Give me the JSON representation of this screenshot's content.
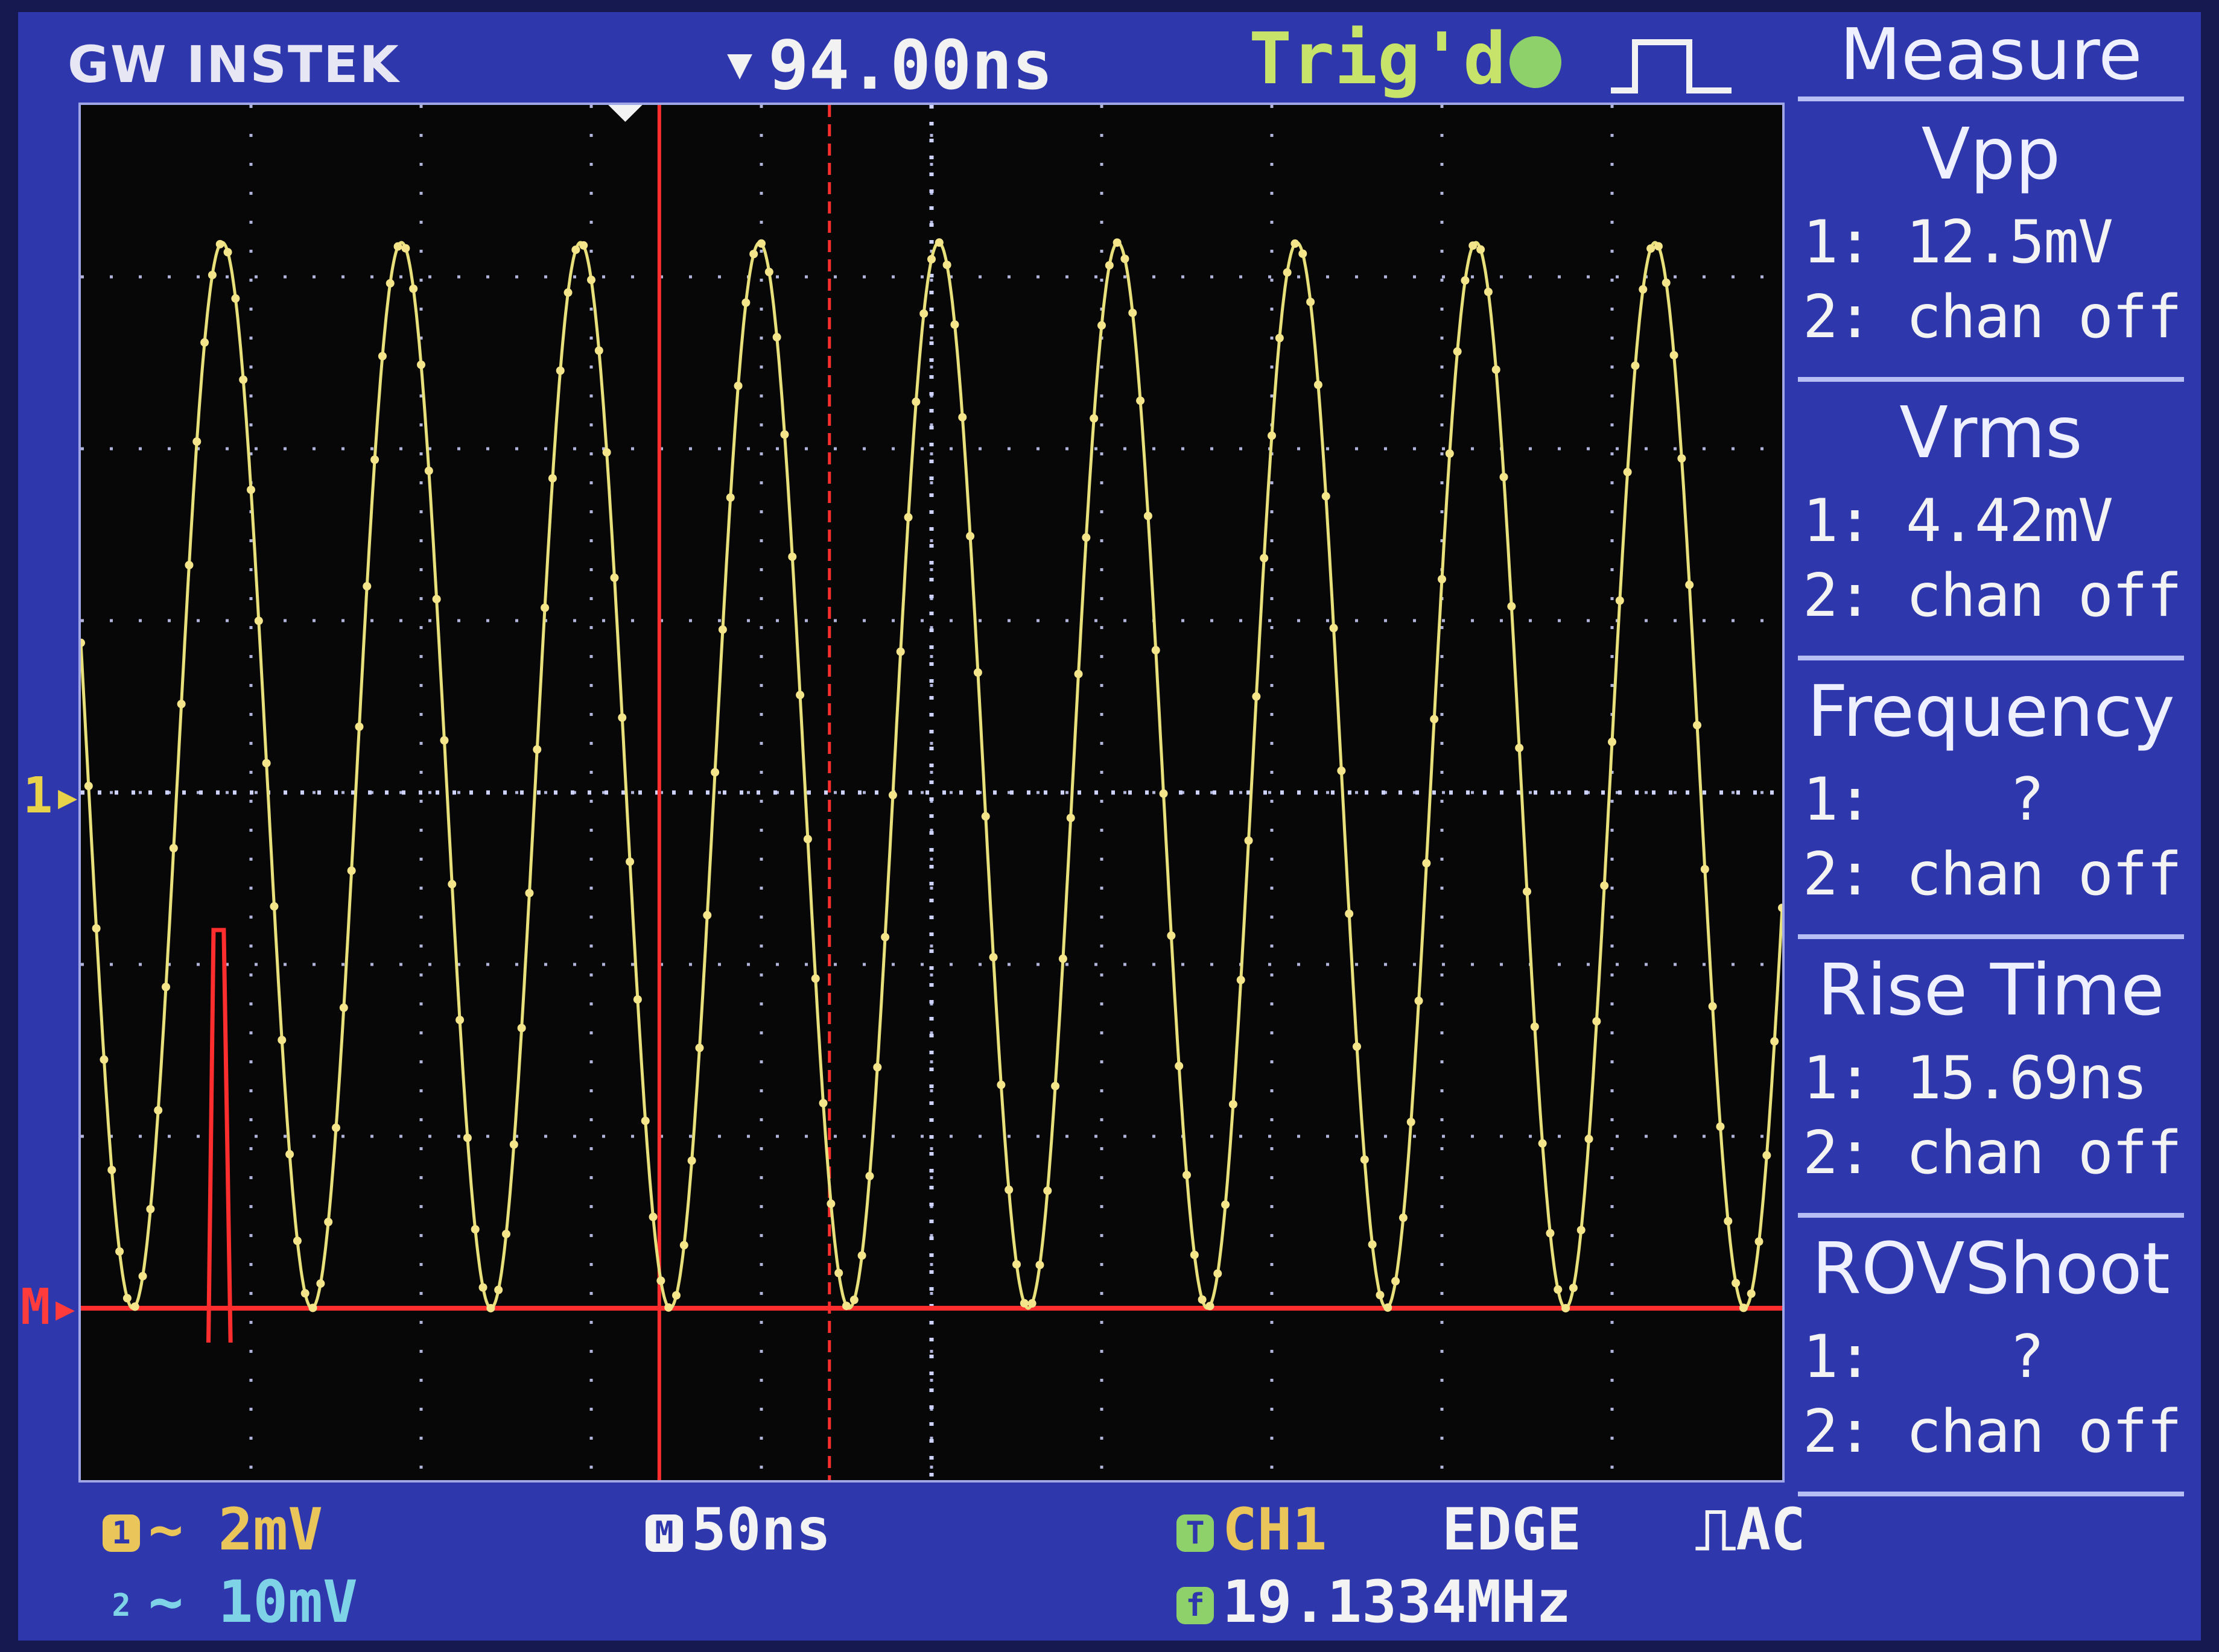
{
  "header": {
    "brand": "GW INSTEK",
    "trigger_position": "94.00ns",
    "trigger_status": "Trig'd",
    "trigger_indicator": "trigger-status-dot"
  },
  "markers": {
    "ch1": "1",
    "math": "M"
  },
  "measure": {
    "title": "Measure",
    "items": [
      {
        "name": "Vpp",
        "ch1": "1: 12.5mV",
        "ch2": "2: chan off"
      },
      {
        "name": "Vrms",
        "ch1": "1: 4.42mV",
        "ch2": "2: chan off"
      },
      {
        "name": "Frequency",
        "ch1": "1:    ?",
        "ch2": "2: chan off"
      },
      {
        "name": "Rise Time",
        "ch1": "1: 15.69ns",
        "ch2": "2: chan off"
      },
      {
        "name": "ROVShoot",
        "ch1": "1:    ?",
        "ch2": "2: chan off"
      }
    ]
  },
  "status": {
    "ch1_scale": "~ 2mV",
    "ch2_scale": "~ 10mV",
    "ch2_chip": "2",
    "timebase_chip": "M",
    "timebase": "50ns",
    "trigger_chip": "T",
    "trigger_source": "CH1",
    "trigger_type": "EDGE",
    "trigger_coupling": "AC",
    "freq_chip": "f",
    "frequency": "19.1334MHz"
  },
  "colors": {
    "ch1_trace": "#e8e07a",
    "math_trace": "#ff2e2e",
    "screen_bg": "#2f37ad",
    "graticule": "#cfd3ff",
    "trig_status": "#c7e36a"
  },
  "chart_data": {
    "type": "line",
    "title": "",
    "xlabel": "",
    "ylabel": "",
    "grid": true,
    "divisions": {
      "x": 10,
      "y": 8
    },
    "series": [
      {
        "name": "1",
        "shape": "sine",
        "cycles_visible": 9.5,
        "vpp_mV": 12.5,
        "frequency_MHz": 19.1334
      },
      {
        "name": "M",
        "shape": "flat",
        "level_div": -3
      }
    ],
    "cursors": [
      "solid-red",
      "dashed-red"
    ]
  }
}
